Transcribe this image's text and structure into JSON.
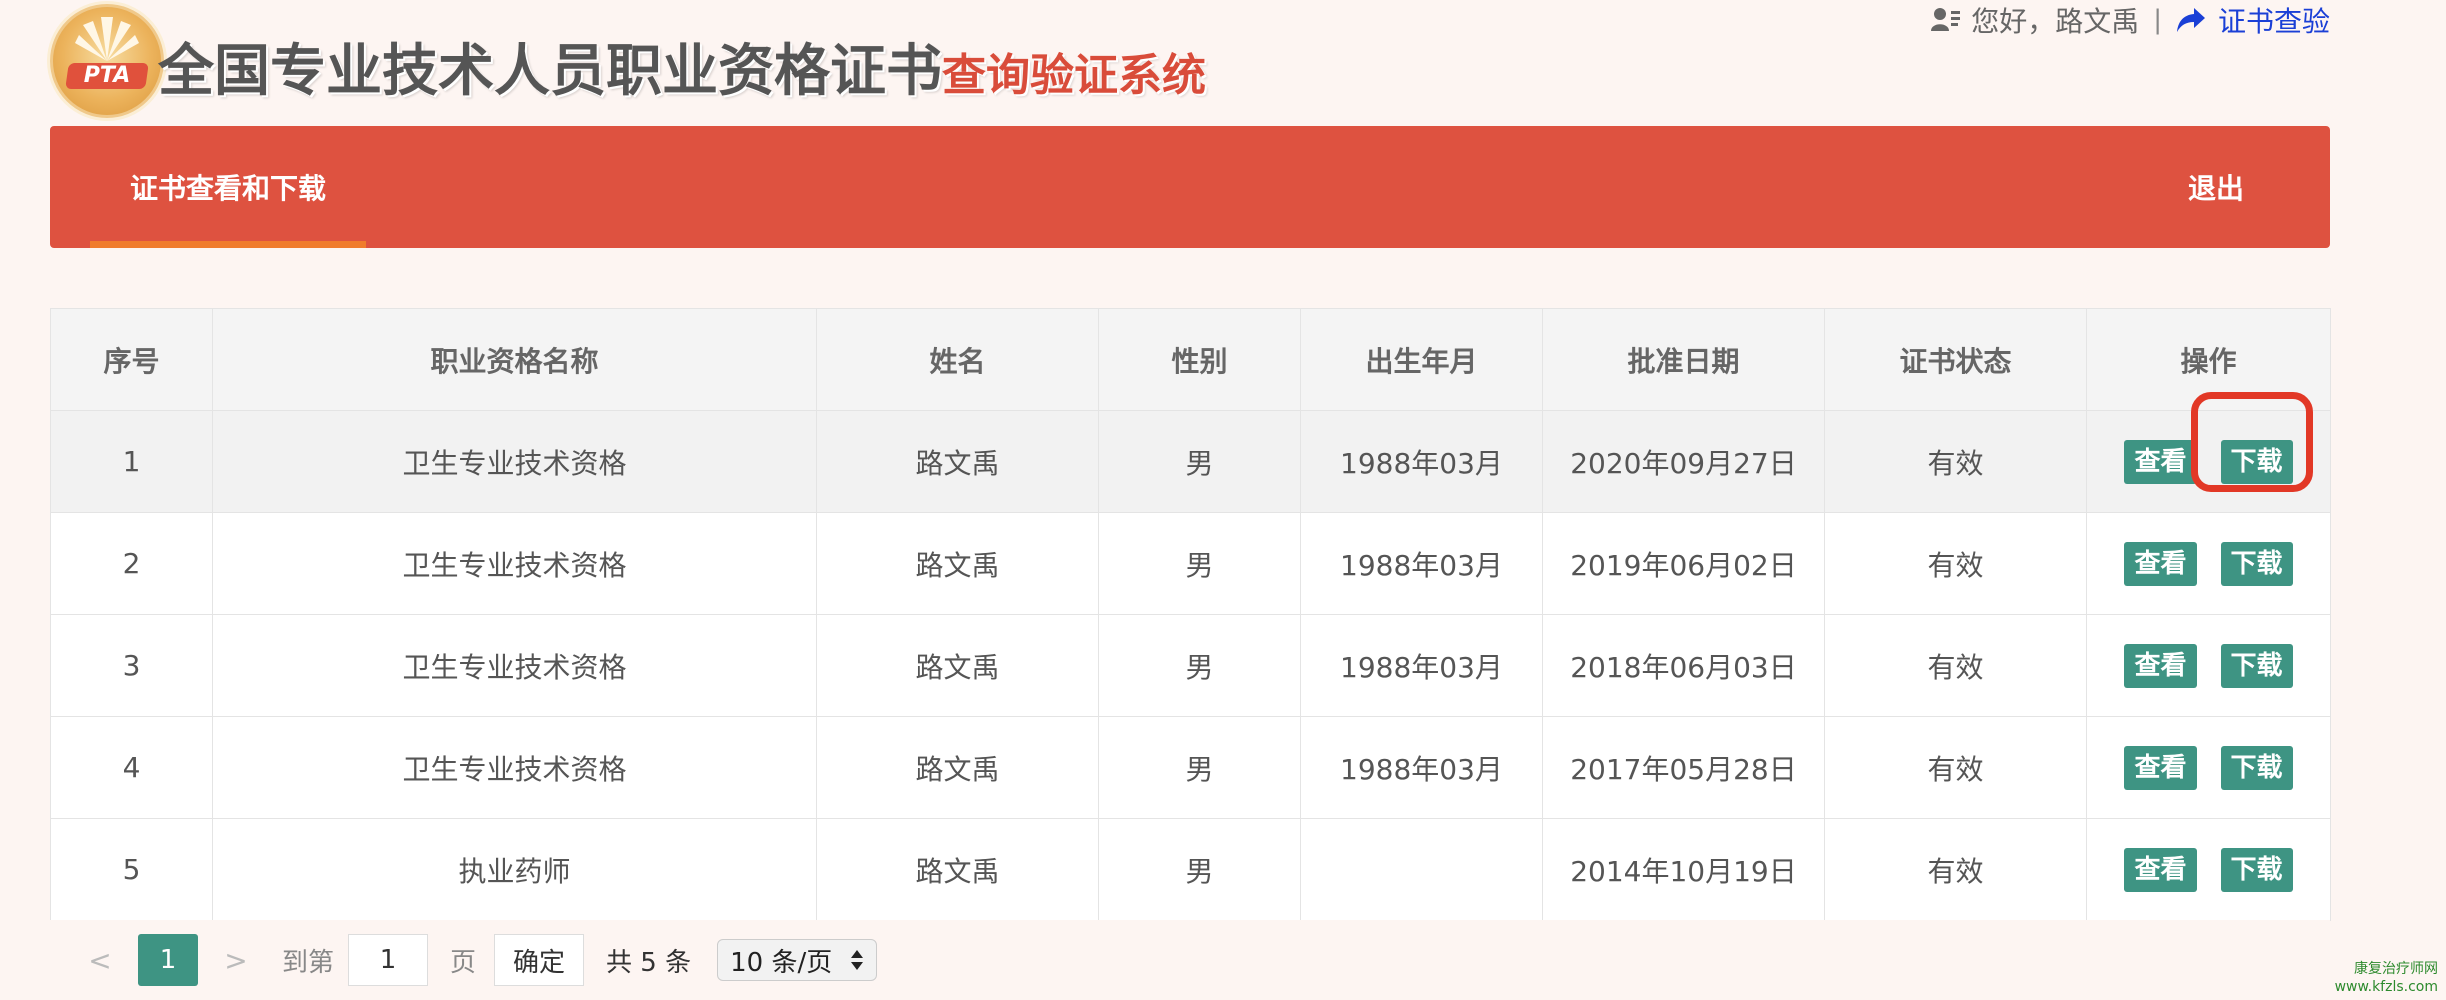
{
  "header": {
    "title_main": "全国专业技术人员职业资格证书",
    "title_sub": "查询验证系统",
    "logo_text": "PTA",
    "greeting": "您好，路文禹",
    "separator": "|",
    "verify_link": "证书查验"
  },
  "nav": {
    "tab_label": "证书查看和下载",
    "logout_label": "退出"
  },
  "table": {
    "headers": [
      "序号",
      "职业资格名称",
      "姓名",
      "性别",
      "出生年月",
      "批准日期",
      "证书状态",
      "操作"
    ],
    "view_label": "查看",
    "download_label": "下载",
    "rows": [
      {
        "no": "1",
        "qualification": "卫生专业技术资格",
        "name": "路文禹",
        "gender": "男",
        "birth": "1988年03月",
        "approved": "2020年09月27日",
        "status": "有效"
      },
      {
        "no": "2",
        "qualification": "卫生专业技术资格",
        "name": "路文禹",
        "gender": "男",
        "birth": "1988年03月",
        "approved": "2019年06月02日",
        "status": "有效"
      },
      {
        "no": "3",
        "qualification": "卫生专业技术资格",
        "name": "路文禹",
        "gender": "男",
        "birth": "1988年03月",
        "approved": "2018年06月03日",
        "status": "有效"
      },
      {
        "no": "4",
        "qualification": "卫生专业技术资格",
        "name": "路文禹",
        "gender": "男",
        "birth": "1988年03月",
        "approved": "2017年05月28日",
        "status": "有效"
      },
      {
        "no": "5",
        "qualification": "执业药师",
        "name": "路文禹",
        "gender": "男",
        "birth": "",
        "approved": "2014年10月19日",
        "status": "有效"
      }
    ]
  },
  "pager": {
    "prev": "<",
    "current_page": "1",
    "next": ">",
    "goto_label": "到第",
    "goto_value": "1",
    "page_unit": "页",
    "confirm_label": "确定",
    "total_label": "共 5 条",
    "page_size": "10 条/页"
  },
  "watermark": {
    "line1": "康复治疗师网",
    "line2": "www.kfzls.com"
  },
  "colors": {
    "nav_bg": "#de5240",
    "tab_underline": "#f07c2d",
    "button_bg": "#3e9483",
    "highlight_ring": "#e23826",
    "link": "#1a3fd6"
  }
}
